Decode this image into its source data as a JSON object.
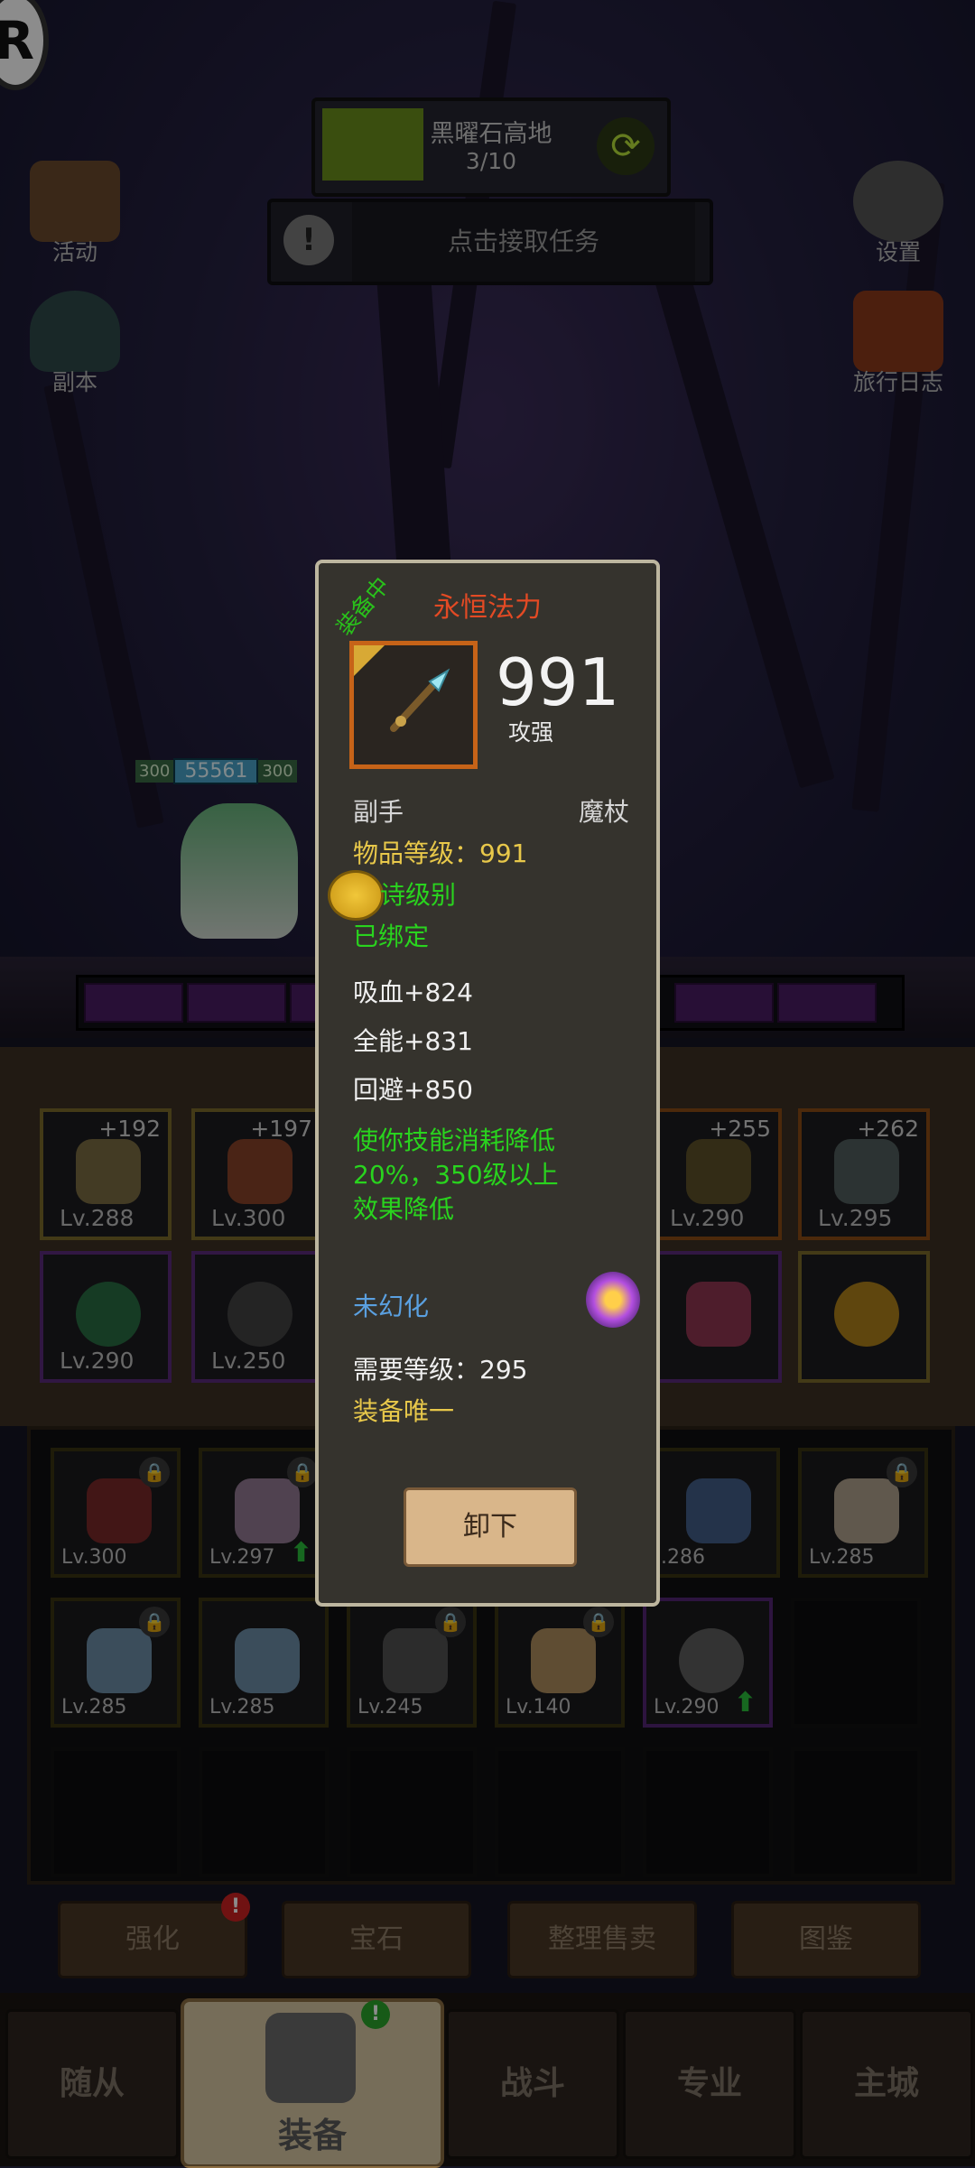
{
  "top": {
    "zone_name": "黑曜石高地",
    "zone_progress": "3/10",
    "zone_progress_fraction": 0.3,
    "task_label": "点击接取任务"
  },
  "side_left": [
    {
      "label": "活动",
      "icon": "event-scroll-icon"
    },
    {
      "label": "副本",
      "icon": "dungeon-portal-icon"
    }
  ],
  "side_right": [
    {
      "label": "设置",
      "icon": "gear-icon"
    },
    {
      "label": "旅行日志",
      "icon": "journal-book-icon"
    }
  ],
  "hero": {
    "hp_tag_left": "300",
    "hp_value": "55561",
    "hp_tag_right": "300"
  },
  "equipment_slots": [
    {
      "plus": "+192",
      "level": "Lv.288",
      "quality": "gold"
    },
    {
      "plus": "+197",
      "level": "Lv.300",
      "quality": "gold"
    },
    {
      "plus": "+255",
      "level": "Lv.290",
      "quality": "orange"
    },
    {
      "plus": "+262",
      "level": "Lv.295",
      "quality": "orange"
    },
    {
      "plus": "",
      "level": "Lv.290",
      "quality": "purple"
    },
    {
      "plus": "",
      "level": "Lv.250",
      "quality": "purple"
    },
    {
      "plus": "",
      "level": "",
      "quality": "purple"
    },
    {
      "plus": "",
      "level": "",
      "quality": "gold"
    }
  ],
  "bag_items": [
    {
      "level": "Lv.300",
      "locked": true,
      "upgrade": false
    },
    {
      "level": "Lv.297",
      "locked": true,
      "upgrade": true
    },
    {
      "level": ".286",
      "locked": false,
      "upgrade": false
    },
    {
      "level": "Lv.285",
      "locked": true,
      "upgrade": false
    },
    {
      "level": "Lv.285",
      "locked": true,
      "upgrade": false
    },
    {
      "level": "Lv.285",
      "locked": false,
      "upgrade": false
    },
    {
      "level": "Lv.245",
      "locked": true,
      "upgrade": false
    },
    {
      "level": "Lv.140",
      "locked": true,
      "upgrade": false
    },
    {
      "level": "Lv.290",
      "locked": false,
      "upgrade": true
    }
  ],
  "actions": [
    {
      "label": "强化",
      "badge": "!"
    },
    {
      "label": "宝石",
      "badge": ""
    },
    {
      "label": "整理售卖",
      "badge": ""
    },
    {
      "label": "图鉴",
      "badge": ""
    }
  ],
  "nav": {
    "followers": "随从",
    "equipment": "装备",
    "battle": "战斗",
    "profession": "专业",
    "main_city": "主城",
    "equipment_badge": "!"
  },
  "tooltip": {
    "equipped_tag": "装备中",
    "name": "永恒法力",
    "item_level_big": "991",
    "stat_caption": "攻强",
    "slot": "副手",
    "type": "魔杖",
    "item_level_line": "物品等级：991",
    "rarity": "诗级别",
    "bound": "已绑定",
    "stats": [
      "吸血+824",
      "全能+831",
      "回避+850"
    ],
    "effect_lines": [
      "使你技能消耗降低",
      "20%，350级以上",
      "效果降低"
    ],
    "transmog": "未幻化",
    "required_level": "需要等级：295",
    "unique": "装备唯一",
    "unequip_button": "卸下"
  },
  "colors": {
    "item_name": "#e34a24",
    "item_level": "#e8c84a",
    "green_text": "#29d41e",
    "transmog": "#5aa0e0",
    "unique": "#e8c84a"
  }
}
